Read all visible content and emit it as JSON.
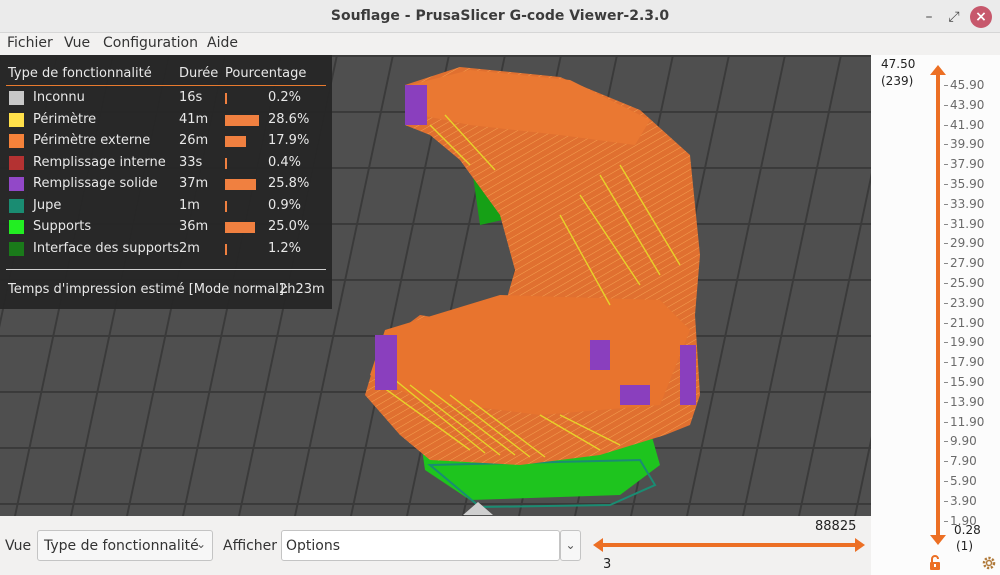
{
  "window": {
    "title": "Souflage - PrusaSlicer G-code Viewer-2.3.0",
    "controls": {
      "minimize": "–",
      "maximize": "⤢",
      "close": "×"
    }
  },
  "menu": {
    "items": [
      "Fichier",
      "Vue",
      "Configuration",
      "Aide"
    ]
  },
  "legend": {
    "headers": {
      "type": "Type de fonctionnalité",
      "duration": "Durée",
      "percentage": "Pourcentage"
    },
    "rows": [
      {
        "name": "Inconnu",
        "duration": "16s",
        "percent": "0.2%",
        "fraction": 0.002,
        "color": "#c8c8c8"
      },
      {
        "name": "Périmètre",
        "duration": "41m",
        "percent": "28.6%",
        "fraction": 0.286,
        "color": "#ffe04a"
      },
      {
        "name": "Périmètre externe",
        "duration": "26m",
        "percent": "17.9%",
        "fraction": 0.179,
        "color": "#f5823a"
      },
      {
        "name": "Remplissage interne",
        "duration": "33s",
        "percent": "0.4%",
        "fraction": 0.004,
        "color": "#b43232"
      },
      {
        "name": "Remplissage solide",
        "duration": "37m",
        "percent": "25.8%",
        "fraction": 0.258,
        "color": "#9248c8"
      },
      {
        "name": "Jupe",
        "duration": "1m",
        "percent": "0.9%",
        "fraction": 0.009,
        "color": "#1a8c72"
      },
      {
        "name": "Supports",
        "duration": "36m",
        "percent": "25.0%",
        "fraction": 0.25,
        "color": "#22ee22"
      },
      {
        "name": "Interface des supports",
        "duration": "2m",
        "percent": "1.2%",
        "fraction": 0.012,
        "color": "#1a7a1a"
      }
    ],
    "estimate_label": "Temps d'impression estimé [Mode normal]:",
    "estimate_value": "2h23m"
  },
  "layer_slider": {
    "top_value": "47.50",
    "top_index": "(239)",
    "bottom_value": "0.28",
    "bottom_index": "(1)",
    "ticks": [
      "45.90",
      "43.90",
      "41.90",
      "39.90",
      "37.90",
      "35.90",
      "33.90",
      "31.90",
      "29.90",
      "27.90",
      "25.90",
      "23.90",
      "21.90",
      "19.90",
      "17.90",
      "15.90",
      "13.90",
      "11.90",
      "9.90",
      "7.90",
      "5.90",
      "3.90",
      "1.90"
    ],
    "accent": "#ec6f24"
  },
  "move_slider": {
    "max": "88825",
    "min": "3"
  },
  "bottom": {
    "view_label": "Vue",
    "view_value": "Type de fonctionnalité",
    "show_label": "Afficher",
    "show_value": "Options"
  }
}
